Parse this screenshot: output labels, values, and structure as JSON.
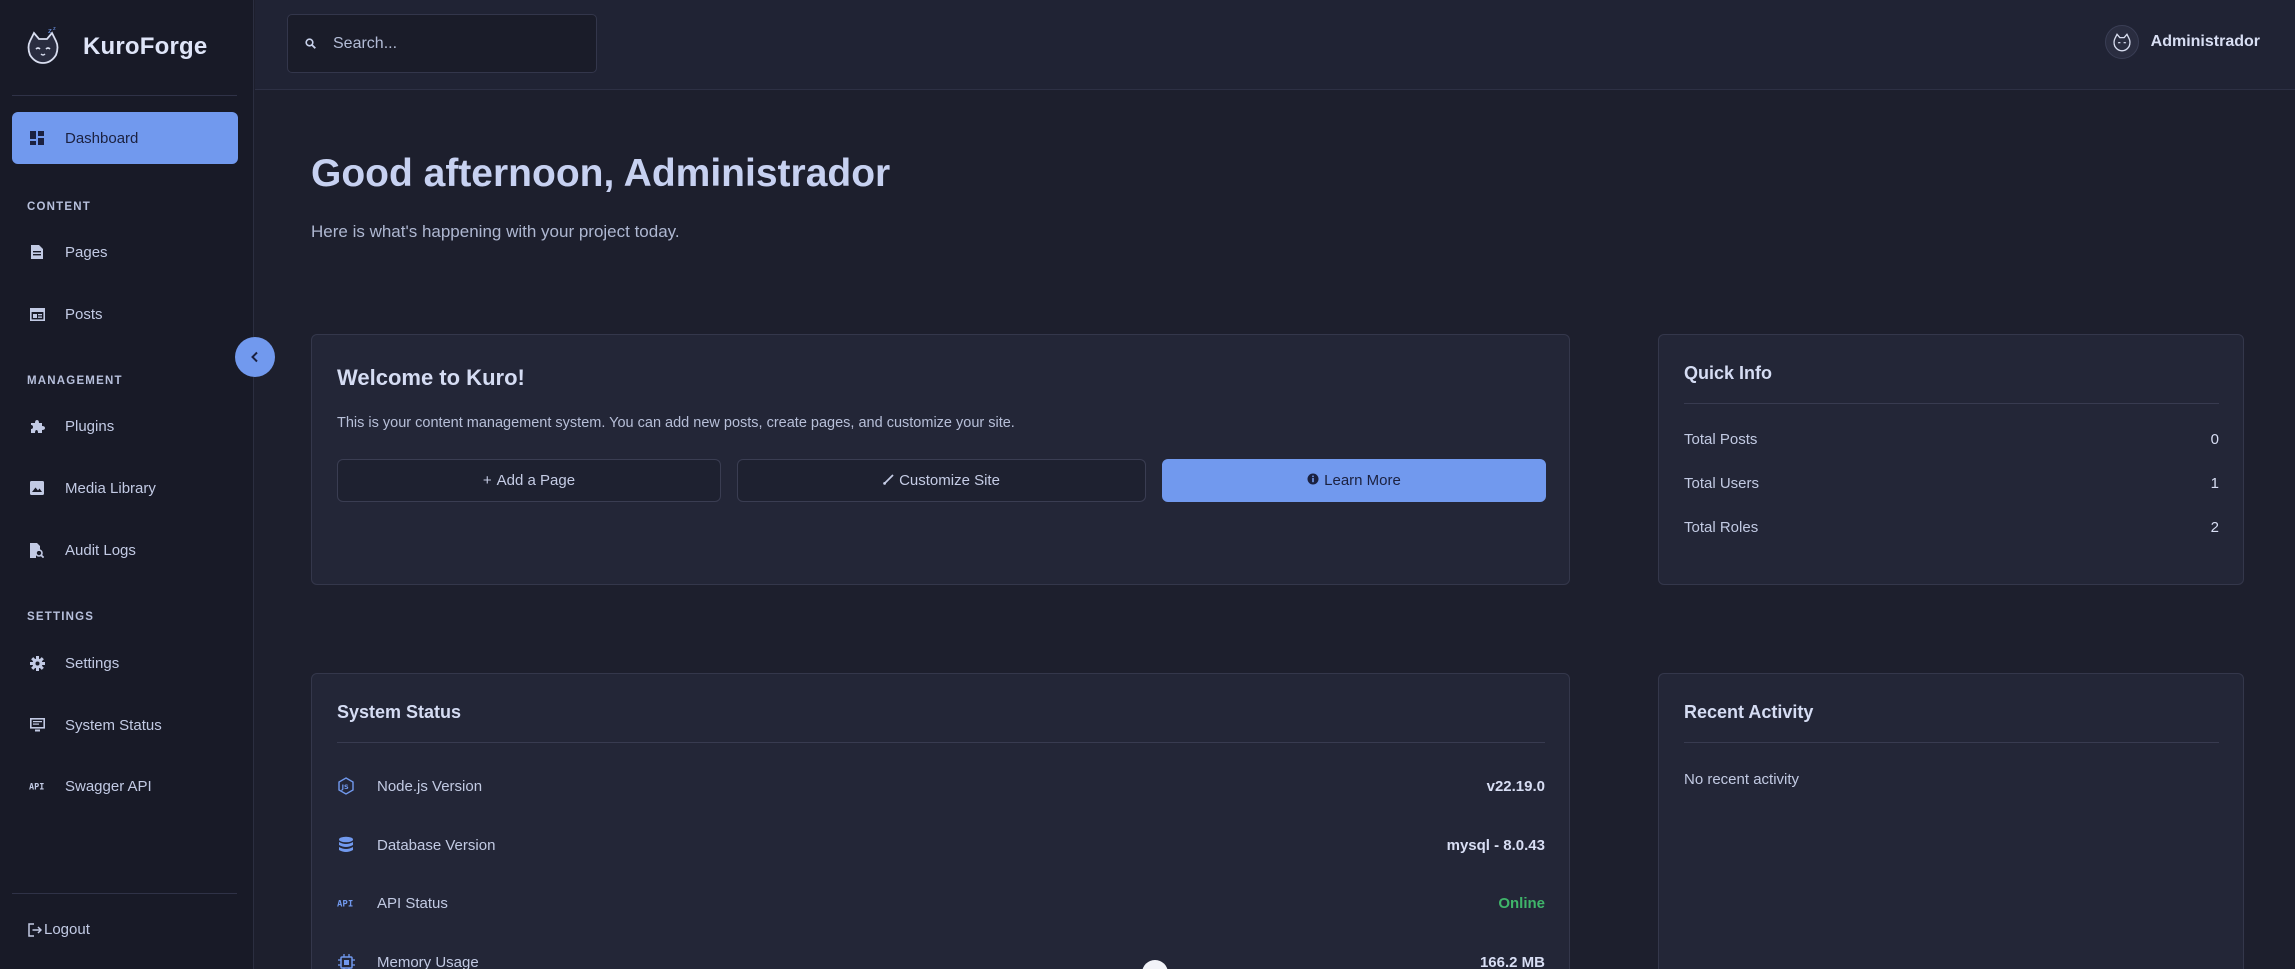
{
  "brand": {
    "name": "KuroForge"
  },
  "search": {
    "placeholder": "Search..."
  },
  "user": {
    "name": "Administrador"
  },
  "sidebar": {
    "items": [
      {
        "label": "Dashboard",
        "icon": "dashboard-icon",
        "active": true
      },
      {
        "label": "Pages",
        "icon": "page-icon"
      },
      {
        "label": "Posts",
        "icon": "posts-icon"
      },
      {
        "label": "Plugins",
        "icon": "puzzle-icon"
      },
      {
        "label": "Media Library",
        "icon": "image-icon"
      },
      {
        "label": "Audit Logs",
        "icon": "audit-log-icon"
      },
      {
        "label": "Settings",
        "icon": "gear-icon"
      },
      {
        "label": "System Status",
        "icon": "monitor-icon"
      },
      {
        "label": "Swagger API",
        "icon": "api-icon"
      }
    ],
    "sections": {
      "content": "CONTENT",
      "management": "MANAGEMENT",
      "settings": "SETTINGS"
    },
    "logout": "Logout"
  },
  "main": {
    "greeting": "Good afternoon, Administrador",
    "subtitle": "Here is what's happening with your project today."
  },
  "welcome": {
    "title": "Welcome to Kuro!",
    "description": "This is your content management system. You can add new posts, create pages, and customize your site.",
    "buttons": {
      "add_page": "Add a Page",
      "customize": "Customize Site",
      "learn_more": "Learn More"
    }
  },
  "quick_info": {
    "title": "Quick Info",
    "rows": [
      {
        "label": "Total Posts",
        "value": "0"
      },
      {
        "label": "Total Users",
        "value": "1"
      },
      {
        "label": "Total Roles",
        "value": "2"
      }
    ]
  },
  "system_status": {
    "title": "System Status",
    "rows": [
      {
        "label": "Node.js Version",
        "value": "v22.19.0",
        "icon": "nodejs-icon"
      },
      {
        "label": "Database Version",
        "value": "mysql - 8.0.43",
        "icon": "database-icon"
      },
      {
        "label": "API Status",
        "value": "Online",
        "icon": "api-icon"
      },
      {
        "label": "Memory Usage",
        "value": "166.2 MB",
        "icon": "chip-icon"
      }
    ],
    "api_icon_text": "API"
  },
  "recent_activity": {
    "title": "Recent Activity",
    "empty": "No recent activity"
  },
  "colors": {
    "accent": "#7199ee",
    "background": "#1d1f2d",
    "sidebar": "#181a27",
    "card": "#232637",
    "online": "#3fb56a"
  }
}
